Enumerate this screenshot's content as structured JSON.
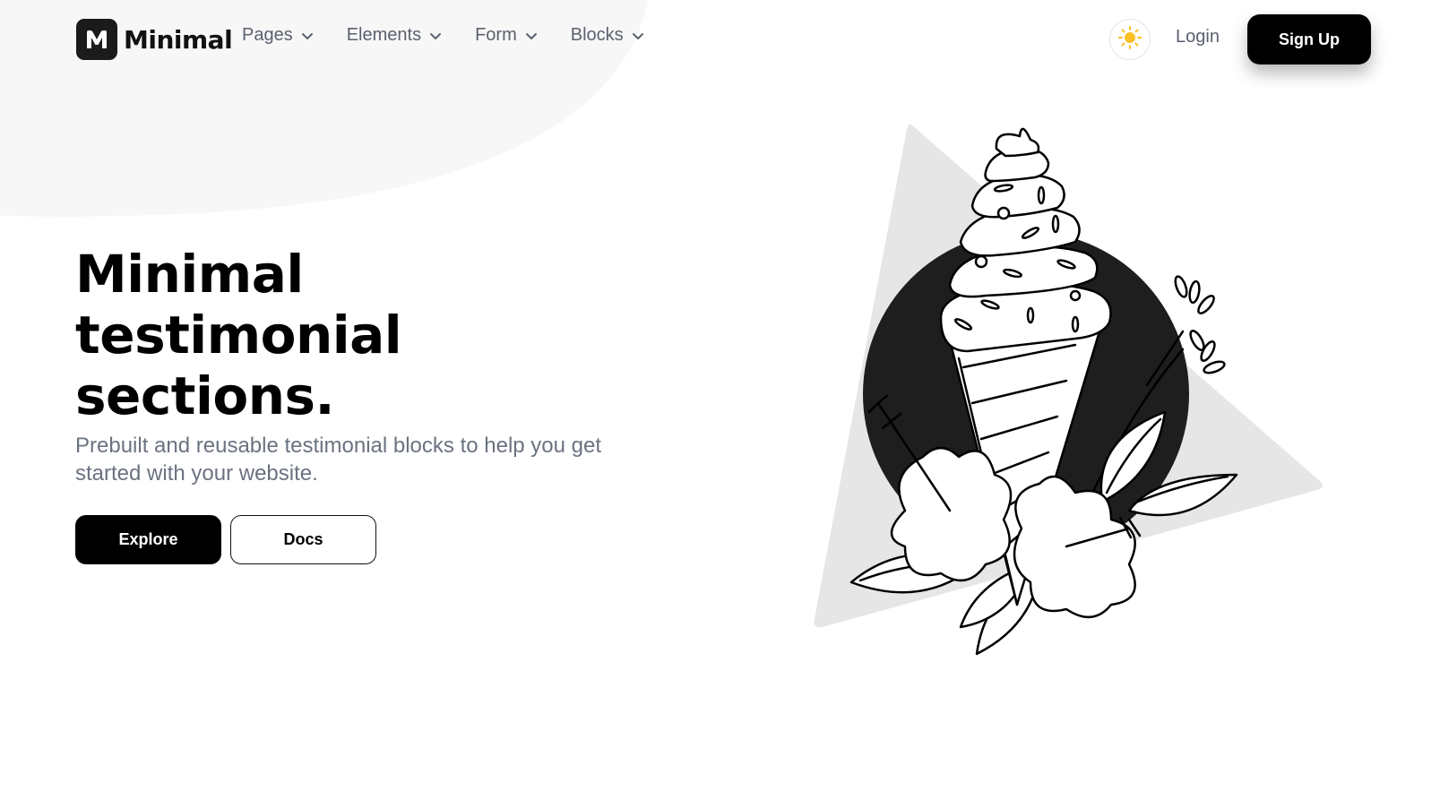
{
  "header": {
    "logo_letter": "M",
    "logo_text": "Minimal",
    "nav": [
      {
        "label": "Pages"
      },
      {
        "label": "Elements"
      },
      {
        "label": "Form"
      },
      {
        "label": "Blocks"
      }
    ],
    "theme_icon": "sun-icon",
    "login_label": "Login",
    "signup_label": "Sign Up"
  },
  "hero": {
    "title_lines": [
      "Minimal",
      "testimonial",
      "sections."
    ],
    "subtitle": "Prebuilt and reusable testimonial blocks to help you get started with your website.",
    "primary_button": "Explore",
    "secondary_button": "Docs"
  },
  "colors": {
    "primary": "#000000",
    "muted_text": "#6b7280",
    "blob": "#f7f7f7",
    "triangle": "#e6e6e6",
    "circle": "#1e1e1e",
    "sun": "#fbbf24"
  },
  "illustration": "ice-cream-cone-with-flowers"
}
